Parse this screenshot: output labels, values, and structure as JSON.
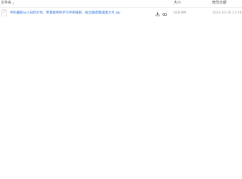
{
  "header": {
    "name_label": "文件名",
    "sort_indicator": "↓",
    "size_label": "大小",
    "date_label": "修改日期"
  },
  "files": [
    {
      "name": "手机摄影从小白到大师，零基础带你学习手机摄影，拍出朋友圈成图大片.zip",
      "size": "628.6M",
      "modified": "2023-10-16 21:08",
      "icon": "zip-file-icon",
      "actions": [
        "download-icon",
        "share-icon"
      ]
    }
  ],
  "colors": {
    "link": "#2a6fd8",
    "text_muted": "#8a8a8a",
    "header_text": "#4d4d4d"
  }
}
